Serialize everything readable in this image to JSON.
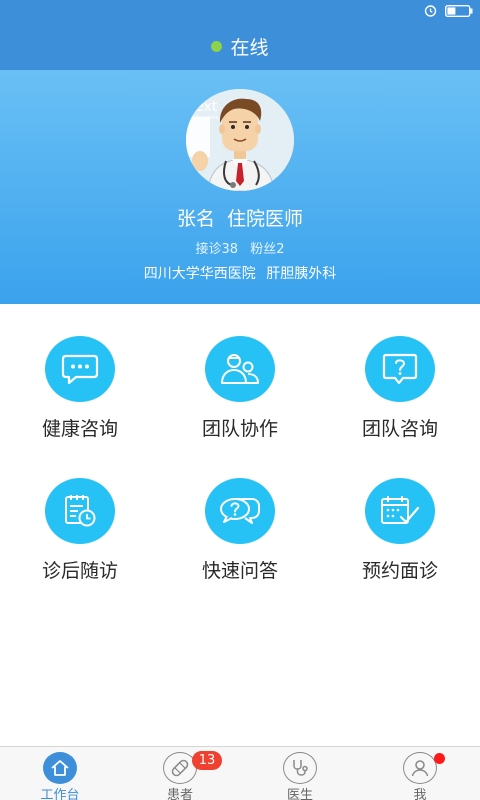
{
  "status_bar": {
    "icons": [
      "alarm-icon",
      "battery-icon"
    ]
  },
  "header": {
    "status_text": "在线",
    "status_color": "#8cd34a",
    "bar_color": "#3d8fd9"
  },
  "profile": {
    "avatar_text": "Text",
    "avatar_subtext": "ur text here",
    "name": "张名",
    "title": "住院医师",
    "consults": "接诊38",
    "fans": "粉丝2",
    "hospital": "四川大学华西医院",
    "department": "肝胆胰外科"
  },
  "features": [
    {
      "label": "健康咨询",
      "icon": "chat-bubble-icon"
    },
    {
      "label": "团队协作",
      "icon": "team-icon"
    },
    {
      "label": "团队咨询",
      "icon": "question-chat-icon"
    },
    {
      "label": "诊后随访",
      "icon": "followup-icon"
    },
    {
      "label": "快速问答",
      "icon": "quick-qa-icon"
    },
    {
      "label": "预约面诊",
      "icon": "calendar-check-icon"
    }
  ],
  "accent_color": "#27c2f5",
  "tabs": [
    {
      "label": "工作台",
      "icon": "home-icon",
      "active": true
    },
    {
      "label": "患者",
      "icon": "bandage-icon",
      "badge": "13"
    },
    {
      "label": "医生",
      "icon": "stethoscope-icon"
    },
    {
      "label": "我",
      "icon": "user-icon",
      "dot": true
    }
  ]
}
